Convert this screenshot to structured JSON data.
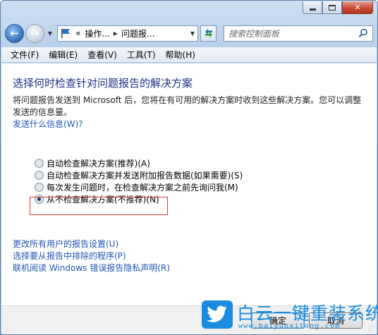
{
  "window": {
    "caption": {
      "minimize": "",
      "maximize": "",
      "close": "✕"
    }
  },
  "nav": {
    "breadcrumb": [
      "«",
      "操作...",
      "问题报..."
    ],
    "search_placeholder": "搜索控制面板"
  },
  "menubar": {
    "items": [
      "文件(F)",
      "编辑(E)",
      "查看(V)",
      "工具(T)",
      "帮助(H)"
    ]
  },
  "main": {
    "heading": "选择何时检查针对问题报告的解决方案",
    "description": "将问题报告发送到 Microsoft 后，您将在有可用的解决方案时收到这些解决方案。您可以调整发送的信息量。",
    "what_info_link": "发送什么信息(W)?",
    "options": [
      {
        "label": "自动检查解决方案(推荐)(A)",
        "checked": false
      },
      {
        "label": "自动检查解决方案并发送附加报告数据(如果需要)(S)",
        "checked": false
      },
      {
        "label": "每次发生问题时，在检查解决方案之前先询问我(M)",
        "checked": false
      },
      {
        "label": "从不检查解决方案(不推荐)(N)",
        "checked": true
      }
    ],
    "links": [
      "更改所有用户的报告设置(U)",
      "选择要从报告中排除的程序(P)",
      "联机阅读 Windows 错误报告隐私声明(R)"
    ]
  },
  "footer": {
    "ok_label": "确定",
    "cancel_label": "取消"
  },
  "watermark": {
    "title": "白云一键重装系统",
    "url": "www.baiyunxitong.com"
  },
  "colors": {
    "heading": "#1e3287",
    "link": "#1f55b4",
    "selection_box": "#d63b3b",
    "watermark": "#1a8be0"
  }
}
